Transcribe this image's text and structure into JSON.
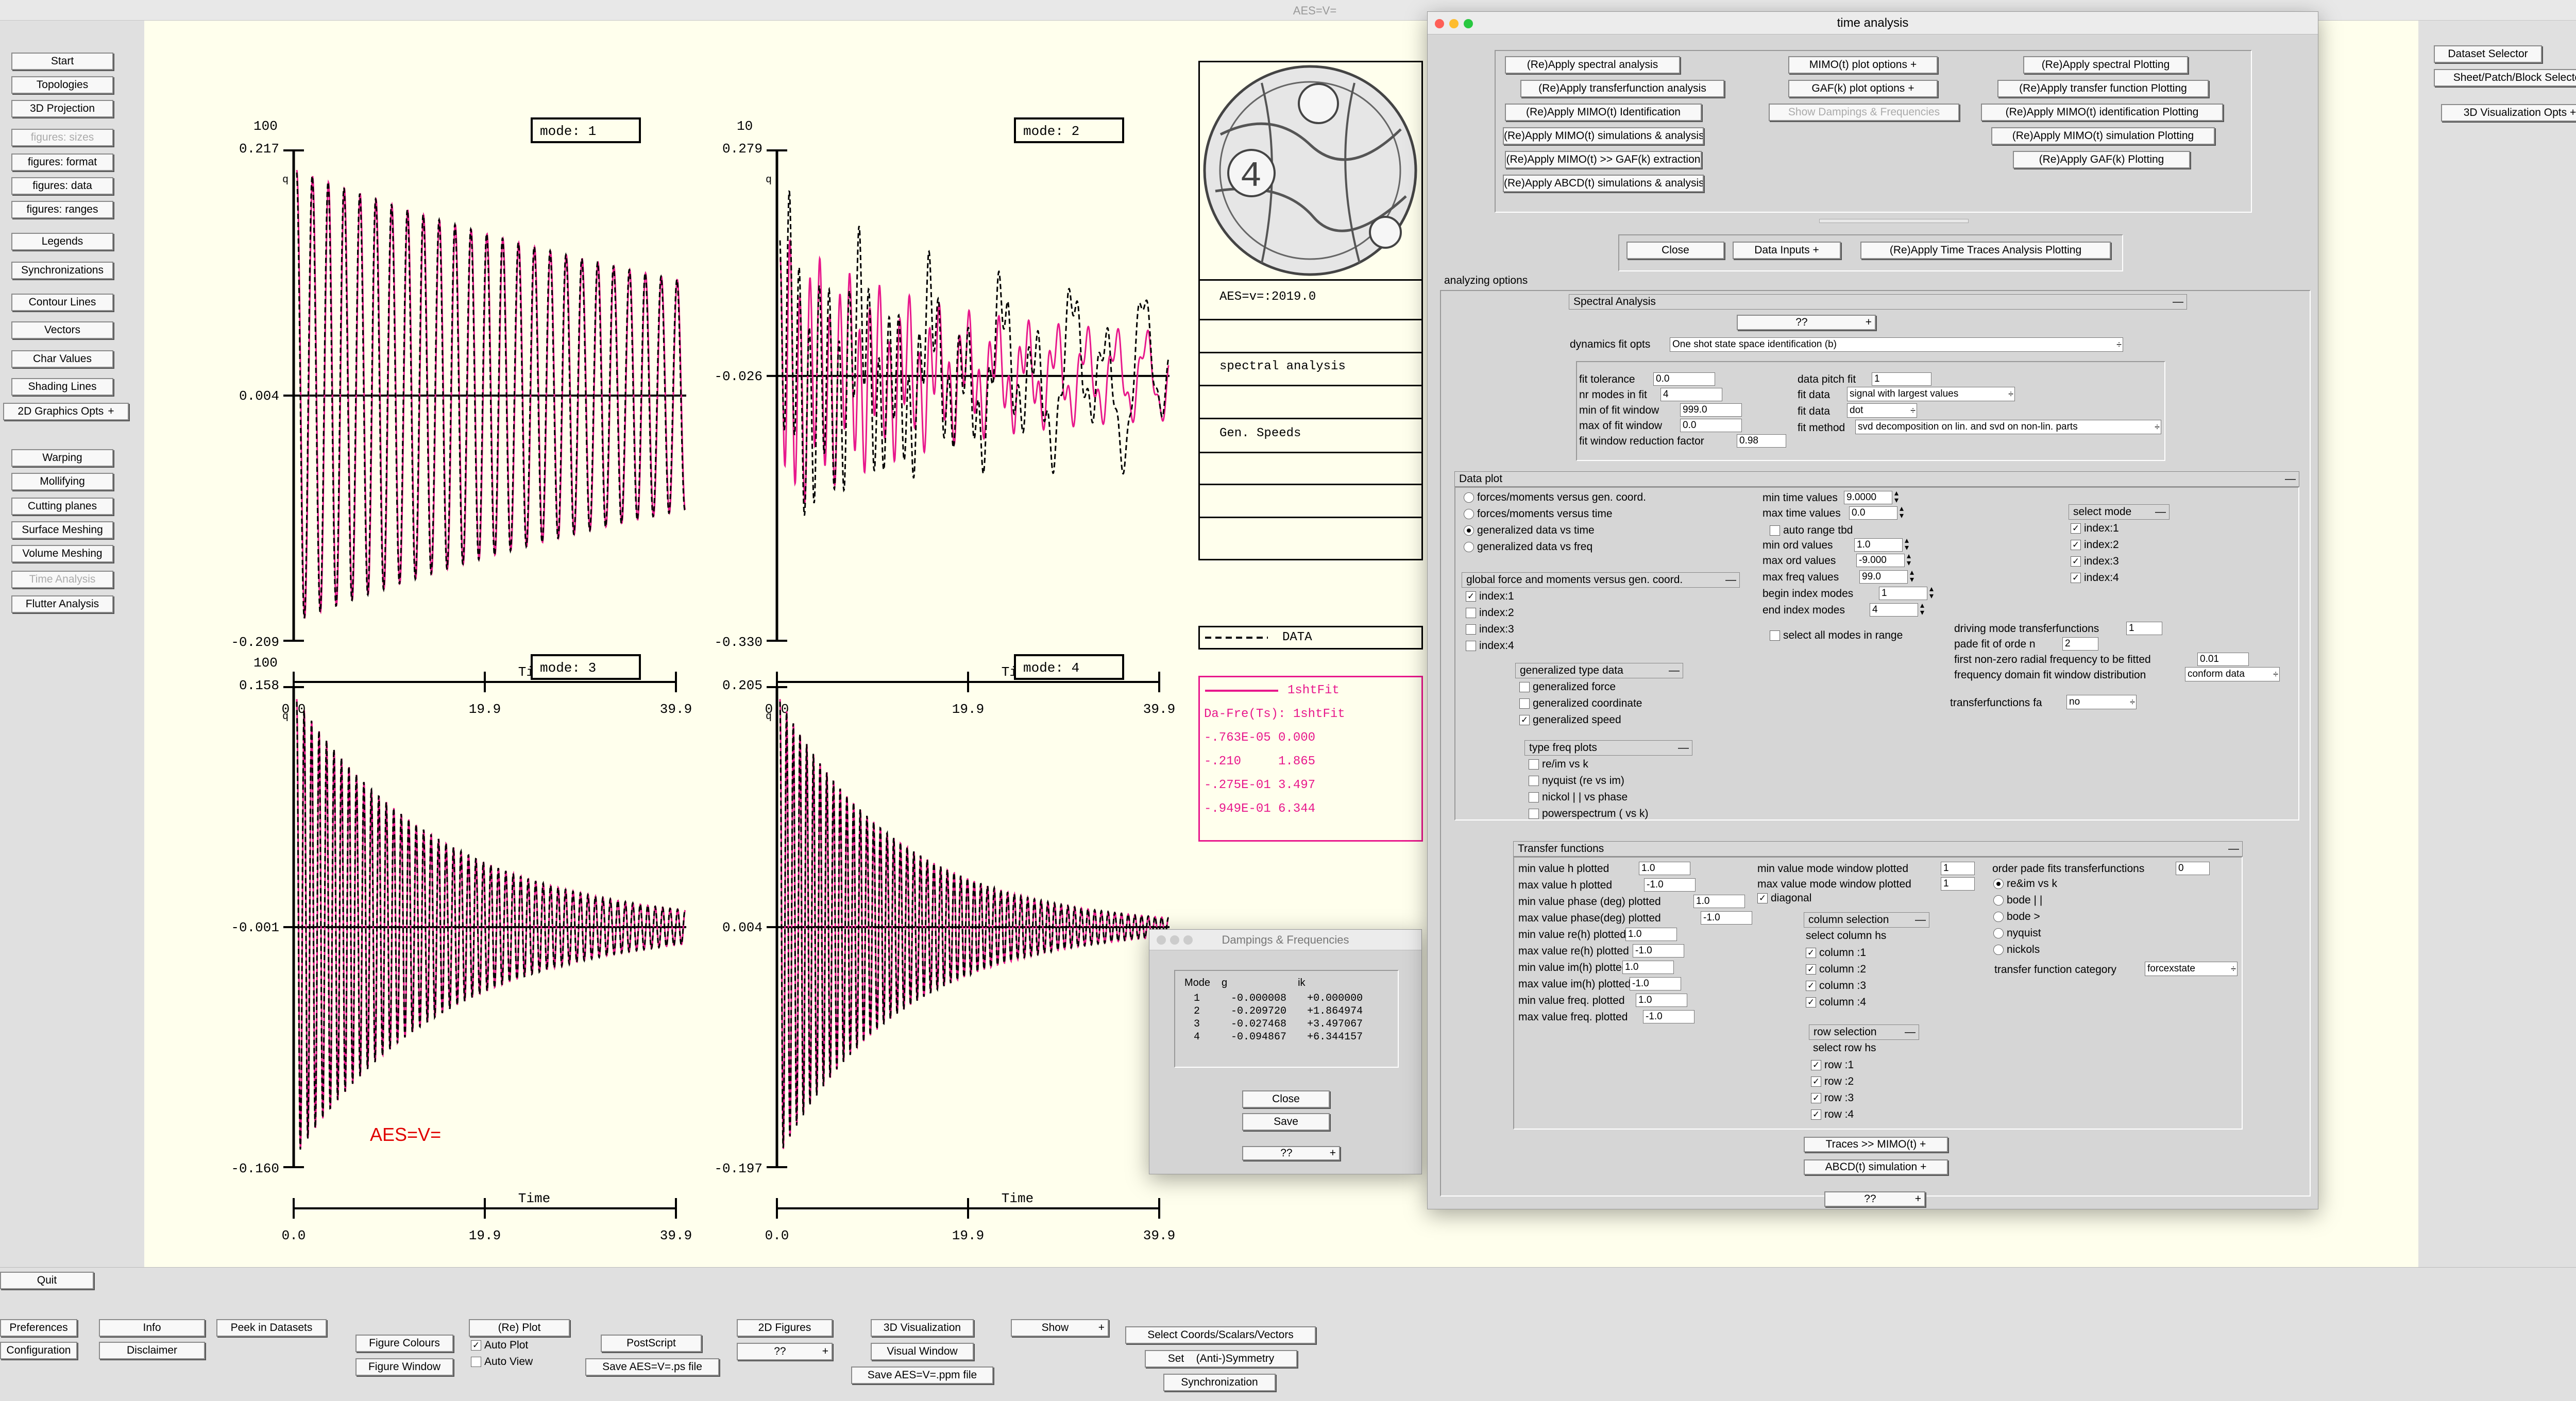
{
  "app": {
    "title": "AES=V="
  },
  "left_menu": [
    "Start",
    "Topologies",
    "3D Projection",
    "figures: sizes",
    "figures: format",
    "figures: data",
    "figures: ranges",
    "Legends",
    "Synchronizations",
    "Contour Lines",
    "Vectors",
    "Char Values",
    "Shading Lines",
    "2D Graphics Opts",
    "Warping",
    "Mollifying",
    "Cutting planes",
    "Surface Meshing",
    "Volume  Meshing",
    "Time Analysis",
    "Flutter Analysis"
  ],
  "right_menu": {
    "dataset": "Dataset Selector",
    "sheet": "Sheet/Patch/Block Selector",
    "vis": "3D Visualization Opts"
  },
  "bottom": {
    "quit": "Quit",
    "preferences": "Preferences",
    "configuration": "Configuration",
    "info": "Info",
    "disclaimer": "Disclaimer",
    "peek": "Peek in Datasets",
    "fig_colours": "Figure Colours",
    "fig_window": "Figure Window",
    "replot": "(Re) Plot",
    "auto_plot": "Auto Plot",
    "auto_view": "Auto View",
    "postscript": "PostScript",
    "save_ps": "Save AES=V=.ps file",
    "g2d": "2D Figures",
    "qq": "??",
    "g3d": "3D Visualization",
    "visual": "Visual Window",
    "save_ppm": "Save AES=V=.ppm file",
    "show": "Show",
    "select_coords": "Select Coords/Scalars/Vectors",
    "set_anti": "Set    (Anti-)Symmetry",
    "sync": "Synchronization"
  },
  "plots": [
    {
      "mode_label": "mode:  1",
      "top_label": "100",
      "y_max": "0.217",
      "y_mid": "0.004",
      "y_min": "-0.209",
      "q": "q",
      "x_ticks": [
        "0.0",
        "19.9",
        "39.9"
      ],
      "x_title": "Time"
    },
    {
      "mode_label": "mode:  2",
      "top_label": "10",
      "y_max": "0.279",
      "y_mid": "-0.026",
      "y_min": "-0.330",
      "q": "q",
      "x_ticks": [
        "0.0",
        "19.9",
        "39.9"
      ],
      "x_title": "Time"
    },
    {
      "mode_label": "mode:  3",
      "top_label": "100",
      "y_max": "0.158",
      "y_mid": "-0.001",
      "y_min": "-0.160",
      "q": "q",
      "x_ticks": [
        "0.0",
        "19.9",
        "39.9"
      ],
      "x_title": "Time"
    },
    {
      "mode_label": "mode:  4",
      "top_label": "",
      "y_max": "0.205",
      "y_mid": "0.004",
      "y_min": "-0.197",
      "q": "q",
      "x_ticks": [
        "0.0",
        "19.9",
        "39.9"
      ],
      "x_title": "Time"
    }
  ],
  "watermark": "AES=V=",
  "info_box": {
    "version": "AES=v=:2019.0",
    "row2": "spectral analysis",
    "row3": "Gen. Speeds",
    "data_legend": "DATA"
  },
  "fit_box": {
    "legend": "1shtFit",
    "header": "Da-Fre(Ts): 1shtFit",
    "rows": [
      "-.763E-05 0.000",
      "-.210     1.865",
      "-.275E-01 3.497",
      "-.949E-01 6.344"
    ]
  },
  "colors": {
    "fit": "#e8188c",
    "data": "#000000",
    "canvas": "#ffffed"
  },
  "dampings": {
    "title": "Dampings & Frequencies",
    "headers": [
      "Mode",
      "g",
      "ik"
    ],
    "rows": [
      [
        "1",
        "-0.000008",
        "+0.000000"
      ],
      [
        "2",
        "-0.209720",
        "+1.864974"
      ],
      [
        "3",
        "-0.027468",
        "+3.497067"
      ],
      [
        "4",
        "-0.094867",
        "+6.344157"
      ]
    ],
    "close": "Close",
    "save": "Save",
    "qq": "??"
  },
  "time_analysis": {
    "title": "time analysis",
    "apply_col1": [
      "(Re)Apply spectral analysis",
      "(Re)Apply transferfunction analysis",
      "(Re)Apply MIMO(t) Identification",
      "(Re)Apply MIMO(t) simulations & analysis",
      "(Re)Apply MIMO(t) >> GAF(k) extraction",
      "(Re)Apply ABCD(t) simulations & analysis"
    ],
    "apply_col2": [
      "MIMO(t) plot options",
      "GAF(k) plot options",
      "Show Dampings & Frequencies"
    ],
    "apply_col3": [
      "(Re)Apply  spectral Plotting",
      "(Re)Apply  transfer function Plotting",
      "(Re)Apply MIMO(t)  identification   Plotting",
      "(Re)Apply  MIMO(t) simulation Plotting",
      "(Re)Apply  GAF(k) Plotting"
    ],
    "close": "Close",
    "data_inputs": "Data Inputs",
    "reapply_traces": "(Re)Apply  Time Traces Analysis Plotting",
    "analyzing_options": "analyzing options",
    "spectral": {
      "head": "Spectral Analysis",
      "qq": "??",
      "dynamics_label": "dynamics  fit opts",
      "dynamics_value": "One shot state space identification (b)",
      "fit_tolerance": "fit tolerance",
      "fit_tolerance_v": "0.0",
      "nr_modes": "nr modes in fit",
      "nr_modes_v": "4",
      "min_window": "min  of fit window",
      "min_window_v": "999.0",
      "max_window": "max of fit window",
      "max_window_v": "0.0",
      "reduction": "fit window reduction factor",
      "reduction_v": "0.98",
      "data_pitch": "data pitch fit",
      "data_pitch_v": "1",
      "fit_data": "fit data",
      "fit_data_v": "signal with largest values",
      "fit_data2": "fit data",
      "fit_data2_v": "dot",
      "fit_method": "fit method",
      "fit_method_v": "svd decomposition on lin. and svd on non-lin. parts"
    },
    "data_plot": {
      "head": "Data plot",
      "radios": [
        "forces/moments versus gen. coord.",
        "forces/moments versus time",
        "generalized data vs time",
        "generalized data vs freq"
      ],
      "global_head": "global force and moments versus gen. coord.",
      "global_items": [
        "index:1",
        "index:2",
        "index:3",
        "index:4"
      ],
      "gen_head": "generalized type data",
      "gen_items": [
        "generalized  force",
        "generalized  coordinate",
        "generalized  speed"
      ],
      "freq_head": "type freq plots",
      "freq_items": [
        "re/im vs k",
        "nyquist (re vs im)",
        "nickol | | vs phase",
        "powerspectrum ( vs k)"
      ],
      "min_time": "min time values",
      "min_time_v": "9.0000",
      "max_time": "max time values",
      "max_time_v": "0.0",
      "auto_range": "auto range tbd",
      "min_ord": "min ord values",
      "min_ord_v": "1.0",
      "max_ord": "max ord values",
      "max_ord_v": "-9.000",
      "max_freq": "max freq values",
      "max_freq_v": "99.0",
      "begin_index": "begin index modes",
      "begin_index_v": "1",
      "end_index": "end index modes",
      "end_index_v": "4",
      "select_all": "select all modes in range",
      "select_mode_head": "select  mode",
      "select_mode_items": [
        "index:1",
        "index:2",
        "index:3",
        "index:4"
      ],
      "driving": "driving mode transferfunctions",
      "driving_v": "1",
      "pade": "pade fit of orde n",
      "pade_v": "2",
      "first_nonzero": "first non-zero radial frequency to be fitted",
      "first_nonzero_v": "0.01",
      "freq_domain": "frequency domain fit window distribution",
      "freq_domain_v": "conform data",
      "tf_fa": "transferfunctions  fa",
      "tf_fa_v": "no"
    },
    "transfer": {
      "head": "Transfer functions",
      "labels": [
        "min value h  plotted",
        "max value h  plotted",
        "min value phase (deg)  plotted",
        "max value  phase(deg)  plotted",
        "min value re(h)  plotted",
        "max value re(h)  plotted",
        "min value im(h)  plotted",
        "max value im(h)  plotted",
        "min value freq.  plotted",
        "max value freq.  plotted"
      ],
      "values": [
        "1.0",
        "-1.0",
        "1.0",
        "-1.0",
        "1.0",
        "-1.0",
        "1.0",
        "-1.0",
        "1.0",
        "-1.0"
      ],
      "min_mode_win": "min value mode window plotted",
      "min_mode_win_v": "1",
      "max_mode_win": "max value mode window plotted",
      "max_mode_win_v": "1",
      "diagonal": "diagonal",
      "col_head": "column selection",
      "col_sub": "select column  hs",
      "col_items": [
        "column :1",
        "column :2",
        "column :3",
        "column :4"
      ],
      "row_head": "row selection",
      "row_sub": "select row hs",
      "row_items": [
        "row :1",
        "row :2",
        "row :3",
        "row :4"
      ],
      "order_pade": "order pade fits transferfunctions",
      "order_pade_v": "0",
      "radios": [
        "re&im vs k",
        "bode | |",
        "bode  >",
        "nyquist",
        "nickols"
      ],
      "category": "transfer function category",
      "category_v": "forcexstate"
    },
    "traces_mimo": "Traces >> MIMO(t)",
    "abcd_sim": "ABCD(t) simulation",
    "qq_bottom": "??"
  }
}
